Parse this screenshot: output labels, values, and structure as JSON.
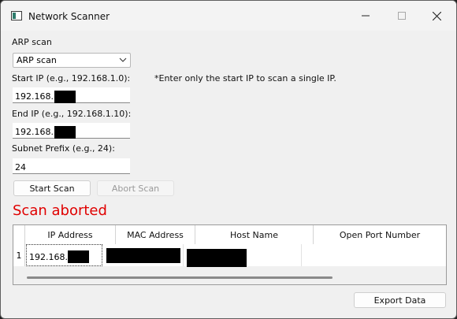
{
  "window": {
    "title": "Network Scanner",
    "controls": {
      "minimize": "—",
      "maximize": "☐",
      "close": "✕"
    }
  },
  "scan_type": {
    "label": "ARP scan",
    "selected": "ARP scan"
  },
  "start_ip": {
    "label": "Start IP (e.g., 192.168.1.0):",
    "hint": "*Enter only the start IP to scan a single IP.",
    "value": "192.168."
  },
  "end_ip": {
    "label": "End IP (e.g., 192.168.1.10):",
    "value": "192.168."
  },
  "subnet": {
    "label": "Subnet Prefix (e.g., 24):",
    "value": "24"
  },
  "buttons": {
    "start_scan": "Start Scan",
    "abort_scan": "Abort Scan",
    "export_data": "Export Data"
  },
  "status": {
    "text": "Scan aborted",
    "color": "#e00000"
  },
  "results": {
    "columns": [
      "IP Address",
      "MAC Address",
      "Host Name",
      "Open Port Number"
    ],
    "rows": [
      {
        "index": "1",
        "ip": "192.168.",
        "mac": "",
        "host": "",
        "ports": ""
      }
    ]
  }
}
